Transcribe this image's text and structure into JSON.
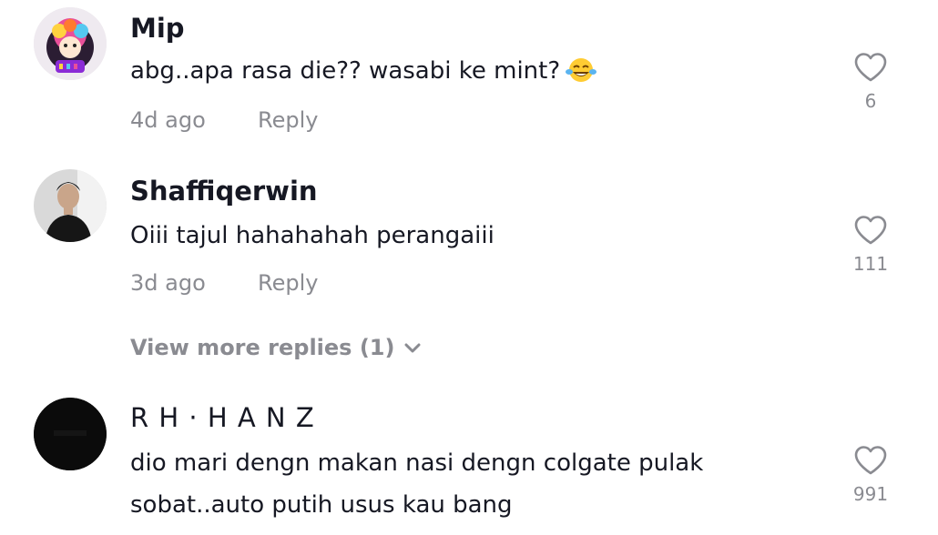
{
  "comments": [
    {
      "username": "Mip",
      "text": "abg..apa rasa die?? wasabi ke mint?",
      "emoji": "laughing-tears-emoji",
      "time": "4d ago",
      "reply_label": "Reply",
      "likes": "6"
    },
    {
      "username": "Shaffiqerwin",
      "text": "Oiii tajul hahahahah perangaiii",
      "time": "3d ago",
      "reply_label": "Reply",
      "likes": "111"
    },
    {
      "username": "R H · H A N Z",
      "text": "dio mari dengn makan nasi dengn colgate pulak sobat..auto putih usus kau bang",
      "likes": "991"
    }
  ],
  "view_more_replies": "View more replies (1)",
  "colors": {
    "text": "#161823",
    "muted": "#8a8b91",
    "background": "#ffffff"
  }
}
